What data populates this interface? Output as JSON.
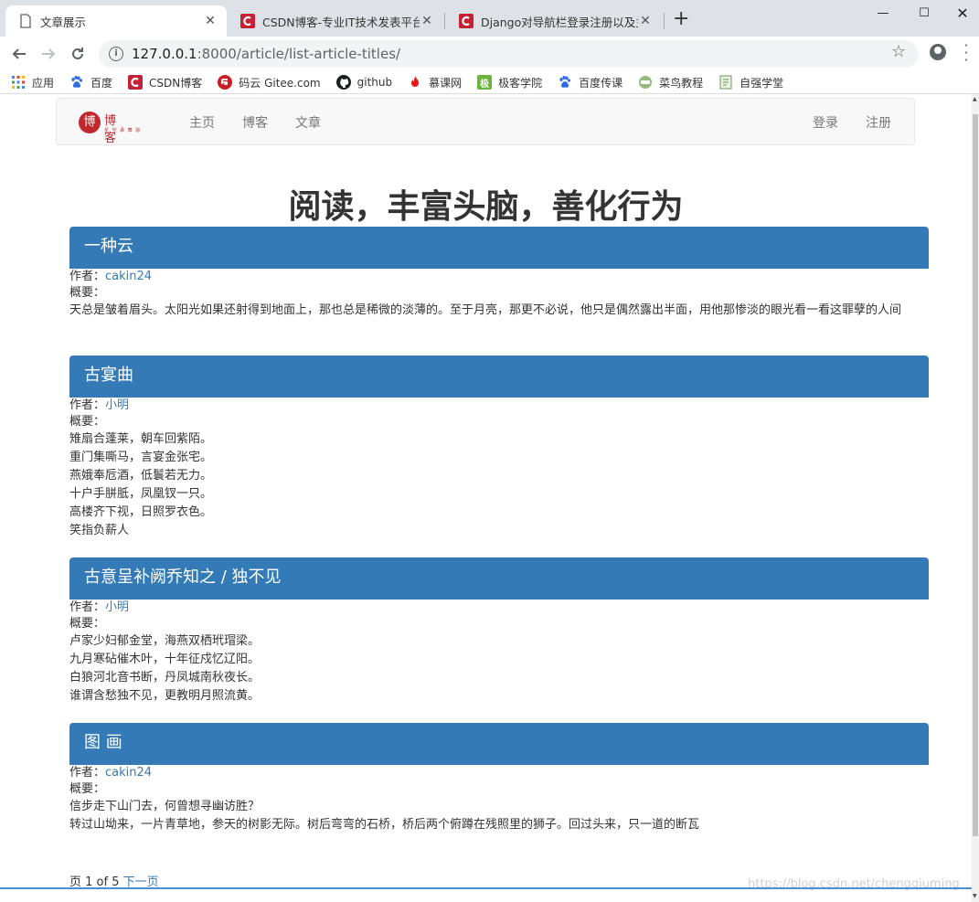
{
  "tabs": [
    {
      "title": "文章展示",
      "active": true
    },
    {
      "title": "CSDN博客-专业IT技术发表平台",
      "active": false
    },
    {
      "title": "Django对导航栏登录注册以及主",
      "active": false
    }
  ],
  "address": {
    "host": "127.0.0.1",
    "path": ":8000/article/list-article-titles/"
  },
  "bookmarks": [
    {
      "label": "应用",
      "icon": "apps-grid-icon"
    },
    {
      "label": "百度",
      "icon": "baidu-paw-icon"
    },
    {
      "label": "CSDN博客",
      "icon": "csdn-icon"
    },
    {
      "label": "码云 Gitee.com",
      "icon": "gitee-icon"
    },
    {
      "label": "github",
      "icon": "github-icon"
    },
    {
      "label": "慕课网",
      "icon": "flame-icon"
    },
    {
      "label": "极客学院",
      "icon": "jikexueyuan-icon"
    },
    {
      "label": "百度传课",
      "icon": "baidu-paw-icon"
    },
    {
      "label": "菜鸟教程",
      "icon": "runoob-icon"
    },
    {
      "label": "自强学堂",
      "icon": "ziqiang-icon"
    }
  ],
  "site": {
    "logo": {
      "seal": "博",
      "word": "博客",
      "sub": "星 空 承 舞 际"
    },
    "nav": [
      "主页",
      "博客",
      "文章"
    ],
    "nav_right": [
      "登录",
      "注册"
    ],
    "hero": "阅读，丰富头脑，善化行为"
  },
  "articles": [
    {
      "title": "一种云",
      "author_label": "作者：",
      "author": "cakin24",
      "summary_label": "概要：",
      "lines": [
        "天总是皱着眉头。太阳光如果还射得到地面上，那也总是稀微的淡薄的。至于月亮，那更不必说，他只是偶然露出半面，用他那惨淡的眼光看一看这罪孽的人间"
      ]
    },
    {
      "title": "古宴曲",
      "author_label": "作者：",
      "author": "小明",
      "summary_label": "概要：",
      "lines": [
        "雉扇合蓬莱，朝车回紫陌。",
        "重门集嘶马，言宴金张宅。",
        "燕娥奉卮酒，低鬟若无力。",
        "十户手胼胝，凤凰钗一只。",
        "高楼齐下视，日照罗衣色。",
        "笑指负薪人"
      ]
    },
    {
      "title": "古意呈补阙乔知之 / 独不见",
      "author_label": "作者：",
      "author": "小明",
      "summary_label": "概要：",
      "lines": [
        "卢家少妇郁金堂，海燕双栖玳瑁梁。",
        "九月寒砧催木叶，十年征戍忆辽阳。",
        "白狼河北音书断，丹凤城南秋夜长。",
        "谁谓含愁独不见，更教明月照流黄。"
      ]
    },
    {
      "title": "图 画",
      "author_label": "作者：",
      "author": "cakin24",
      "summary_label": "概要：",
      "lines": [
        "信步走下山门去，何曾想寻幽访胜？",
        "转过山坳来，一片青草地，参天的树影无际。树后弯弯的石桥，桥后两个俯蹲在残照里的狮子。回过头来，只一道的断瓦"
      ]
    }
  ],
  "pager": {
    "text": "页 1 of 5",
    "next": "下一页"
  },
  "watermark": "https://blog.csdn.net/chengqiuming",
  "colors": {
    "primary": "#337ab7",
    "chrome": "#dee1e6",
    "csdn_red": "#c32136"
  }
}
